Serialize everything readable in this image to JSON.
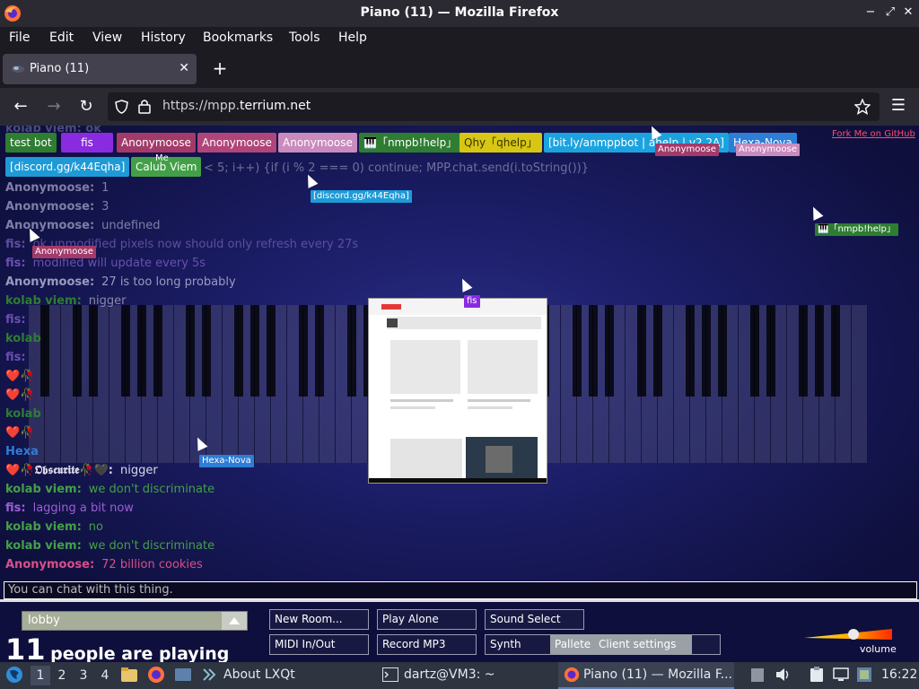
{
  "window": {
    "title": "Piano (11) — Mozilla Firefox"
  },
  "menubar": [
    "File",
    "Edit",
    "View",
    "History",
    "Bookmarks",
    "Tools",
    "Help"
  ],
  "tab": {
    "title": "Piano (11)"
  },
  "nav": {
    "url_prefix": "https://mpp.",
    "url_domain": "terrium.net"
  },
  "page": {
    "fork_link": "Fork Me on GitHub",
    "partial_top_line": "kolab viem:  ok",
    "partial_code": "< 5; i++) {if (i % 2 === 0) continue; MPP.chat.send(i.toString())}",
    "participants": [
      {
        "name": "test bot",
        "color": "#2e7d32"
      },
      {
        "name": "fis",
        "color": "#8a2be2"
      },
      {
        "name": "Anonymoose",
        "color": "#a23b6a"
      },
      {
        "name": "Anonymoose",
        "color": "#b0457a"
      },
      {
        "name": "Anonymoose",
        "color": "#c98bbd"
      },
      {
        "name": "🎹「nmpb!help」",
        "color": "#2e7d32"
      },
      {
        "name": "Qhy「qhelp」",
        "color": "#d7c613"
      },
      {
        "name": "[bit.ly/anmppbot | ahelp | v2.2A]",
        "color": "#1ba3e0"
      },
      {
        "name": "Hexa-Nova",
        "color": "#2e7dd7"
      },
      {
        "name": "[discord.gg/k44Eqha]",
        "color": "#1e9ad6"
      },
      {
        "name": "Calub Viem",
        "color": "#43a047"
      }
    ],
    "cursor_labels": [
      {
        "name": "Me",
        "color": "transparent"
      },
      {
        "name": "Anonymoose",
        "color": "#a23b6a"
      },
      {
        "name": "Anonymoose",
        "color": "#c98bbd"
      },
      {
        "name": "[discord.gg/k44Eqha]",
        "color": "#1e9ad6"
      },
      {
        "name": "🎹「nmpb!help」",
        "color": "#2e7d32"
      },
      {
        "name": "Anonymoose",
        "color": "#a23b6a"
      },
      {
        "name": "fis",
        "color": "#8a2be2"
      },
      {
        "name": "Hexa-Nova",
        "color": "#2e7dd7"
      }
    ],
    "chat": [
      {
        "name": "Anonymoose:",
        "msg": "1",
        "name_color": "#7f7fa6",
        "msg_color": "#7f7fa6"
      },
      {
        "name": "Anonymoose:",
        "msg": "3",
        "name_color": "#7f7fa6",
        "msg_color": "#7f7fa6"
      },
      {
        "name": "Anonymoose:",
        "msg": "undefined",
        "name_color": "#7f7fa6",
        "msg_color": "#7f7fa6"
      },
      {
        "name": "fis:",
        "msg": "ok unmodified pixels now should only refresh every 27s",
        "name_color": "#5f4da0",
        "msg_color": "#5f4da0"
      },
      {
        "name": "fis:",
        "msg": "modified will update every 5s",
        "name_color": "#6a4fb0",
        "msg_color": "#6a4fb0"
      },
      {
        "name": "Anonymoose:",
        "msg": "27 is too long probably",
        "name_color": "#9a9ac0",
        "msg_color": "#9a9ac0"
      },
      {
        "name": "kolab viem:",
        "msg": "nigger",
        "name_color": "#2e7d32",
        "msg_color": "#8a8aa8"
      },
      {
        "name": "❤️🥀𝕺𝖇𝖘𝖈𝖚𝖗𝖎𝖙𝖊🥀🖤:",
        "msg": "nigger",
        "name_color": "#d8d8e8",
        "msg_color": "#d8d8e8"
      },
      {
        "name": "kolab viem:",
        "msg": "we don't discriminate",
        "name_color": "#43a047",
        "msg_color": "#43a047"
      },
      {
        "name": "fis:",
        "msg": "lagging a bit now",
        "name_color": "#9b5fd6",
        "msg_color": "#9b5fd6"
      },
      {
        "name": "kolab viem:",
        "msg": "no",
        "name_color": "#43a047",
        "msg_color": "#43a047"
      },
      {
        "name": "kolab viem:",
        "msg": "we don't discriminate",
        "name_color": "#43a047",
        "msg_color": "#43a047"
      },
      {
        "name": "Anonymoose:",
        "msg": "72 billion cookies",
        "name_color": "#d6508a",
        "msg_color": "#d6508a"
      }
    ],
    "chat_partial_names": [
      "fis:",
      "kolab",
      "fis:",
      "❤️🥀",
      "❤️🥀",
      "kolab",
      "❤️🥀",
      "Hexa"
    ],
    "chat_input_placeholder": "You can chat with this thing.",
    "lobby": "lobby",
    "player_count": "11",
    "players_label": "people are playing",
    "buttons": {
      "new_room": "New Room...",
      "play_alone": "Play Alone",
      "sound_select": "Sound Select",
      "midi": "MIDI In/Out",
      "record": "Record MP3",
      "synth": "Synth",
      "pallete": "Pallete",
      "client_settings": "Client settings"
    },
    "volume_label": "volume",
    "volume_level": 0.57
  },
  "taskbar": {
    "workspaces": [
      "1",
      "2",
      "3",
      "4"
    ],
    "about": "About LXQt",
    "terminal": "dartz@VM3: ~",
    "firefox": "Piano (11) — Mozilla F...",
    "clock": "16:22"
  }
}
